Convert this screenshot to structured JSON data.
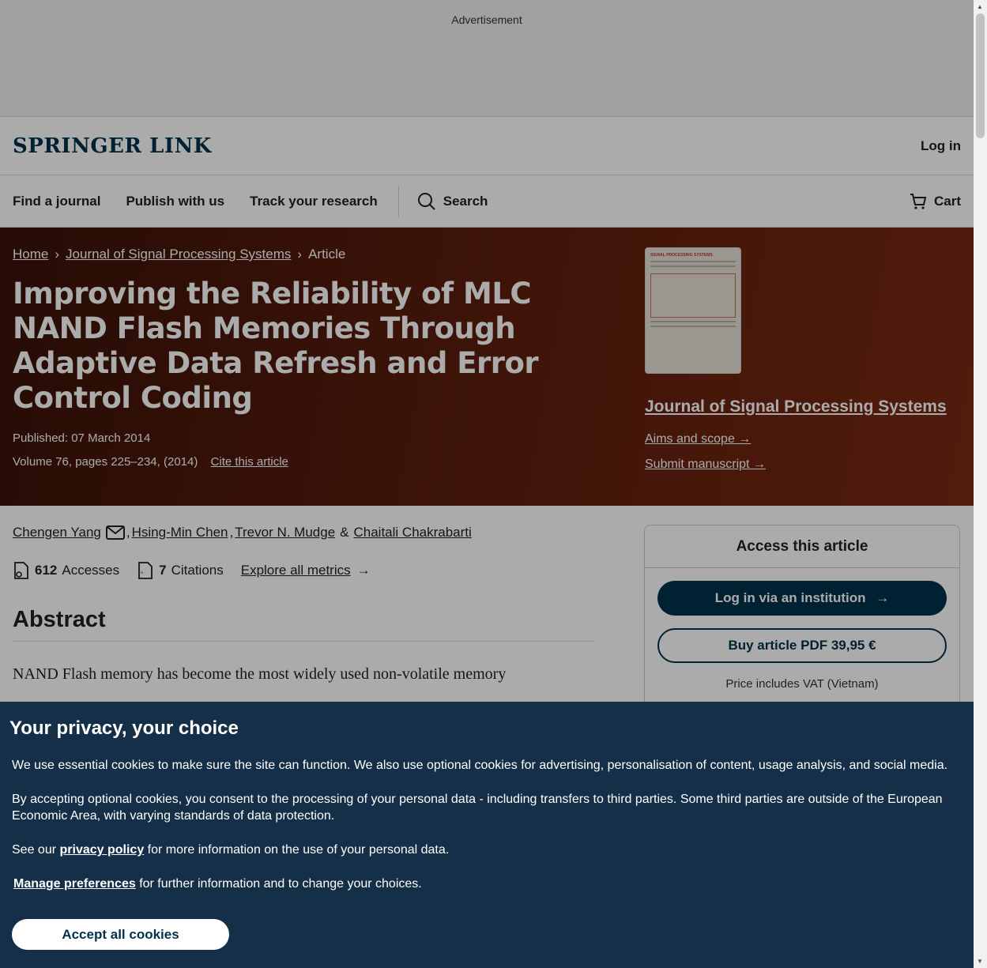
{
  "ad": {
    "label": "Advertisement"
  },
  "header": {
    "logo": "SPRINGER LINK",
    "login": "Log in"
  },
  "nav": {
    "items": [
      "Find a journal",
      "Publish with us",
      "Track your research"
    ],
    "search": "Search",
    "cart": "Cart"
  },
  "breadcrumb": {
    "home": "Home",
    "journal": "Journal of Signal Processing Systems",
    "current": "Article"
  },
  "article": {
    "title": "Improving the Reliability of MLC NAND Flash Memories Through Adaptive Data Refresh and Error Control Coding",
    "published": "Published: 07 March 2014",
    "volume": "Volume 76, pages 225–234, (2014)",
    "cite": "Cite this article"
  },
  "journal": {
    "cover_title": "SIGNAL PROCESSING SYSTEMS",
    "name": "Journal of Signal Processing Systems",
    "aims": "Aims and scope",
    "submit": "Submit manuscript"
  },
  "authors": [
    "Chengen Yang",
    "Hsing-Min Chen",
    "Trevor N. Mudge",
    "Chaitali Chakrabarti"
  ],
  "author_sep": {
    "comma": ",",
    "amp": "&"
  },
  "metrics": {
    "accesses_count": "612",
    "accesses_label": "Accesses",
    "citations_count": "7",
    "citations_label": "Citations",
    "explore": "Explore all metrics"
  },
  "abstract": {
    "heading": "Abstract",
    "text": "NAND Flash memory has become the most widely used non-volatile memory"
  },
  "access": {
    "heading": "Access this article",
    "institution_button": "Log in via an institution",
    "buy_button": "Buy article PDF 39,95 €",
    "vat": "Price includes VAT (Vietnam)"
  },
  "privacy": {
    "heading": "Your privacy, your choice",
    "p1": "We use essential cookies to make sure the site can function. We also use optional cookies for advertising, personalisation of content, usage analysis, and social media.",
    "p2": "By accepting optional cookies, you consent to the processing of your personal data - including transfers to third parties. Some third parties are outside of the European Economic Area, with varying standards of data protection.",
    "p3_prefix": "See our",
    "p3_link": "privacy policy",
    "p3_suffix": "for more information on the use of your personal data.",
    "p4_link": "Manage preferences",
    "p4_suffix": "for further information and to change your choices.",
    "accept": "Accept all cookies"
  },
  "colors": {
    "brand": "#01324b",
    "hero_start": "#3a1208",
    "hero_end": "#7a2a12",
    "banner": "#142f47"
  }
}
